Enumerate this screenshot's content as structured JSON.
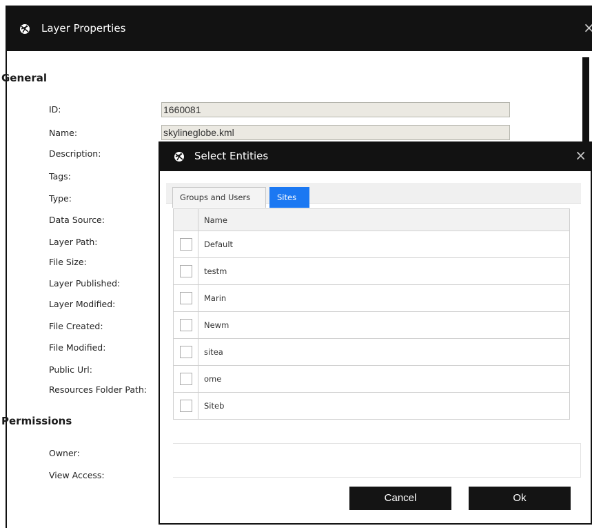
{
  "base_dialog": {
    "title": "Layer Properties",
    "close_glyph": "×",
    "general": {
      "heading": "General",
      "fields": [
        {
          "label": "ID:",
          "value": "1660081"
        },
        {
          "label": "Name:",
          "value": "skylineglobe.kml"
        },
        {
          "label": "Description:"
        },
        {
          "label": "Tags:"
        },
        {
          "label": "Type:"
        },
        {
          "label": "Data Source:"
        },
        {
          "label": "Layer Path:"
        },
        {
          "label": "File Size:"
        },
        {
          "label": "Layer Published:"
        },
        {
          "label": "Layer Modified:"
        },
        {
          "label": "File Created:"
        },
        {
          "label": "File Modified:"
        },
        {
          "label": "Public Url:"
        },
        {
          "label": "Resources Folder Path:"
        }
      ]
    },
    "permissions": {
      "heading": "Permissions",
      "fields": [
        {
          "label": "Owner:"
        },
        {
          "label": "View Access:"
        }
      ]
    }
  },
  "select_dialog": {
    "title": "Select Entities",
    "close_glyph": "×",
    "tabs": [
      {
        "label": "Groups and Users",
        "active": false
      },
      {
        "label": "Sites",
        "active": true
      }
    ],
    "table": {
      "header": "Name",
      "rows": [
        "Default",
        "testm",
        "Marin",
        "Newm",
        "sitea",
        "ome",
        "Siteb"
      ]
    },
    "buttons": {
      "cancel": "Cancel",
      "ok": "Ok"
    }
  },
  "colors": {
    "titlebar": "#121212",
    "accent_tab": "#1b78f2",
    "input_bg": "#ebe9e2"
  }
}
